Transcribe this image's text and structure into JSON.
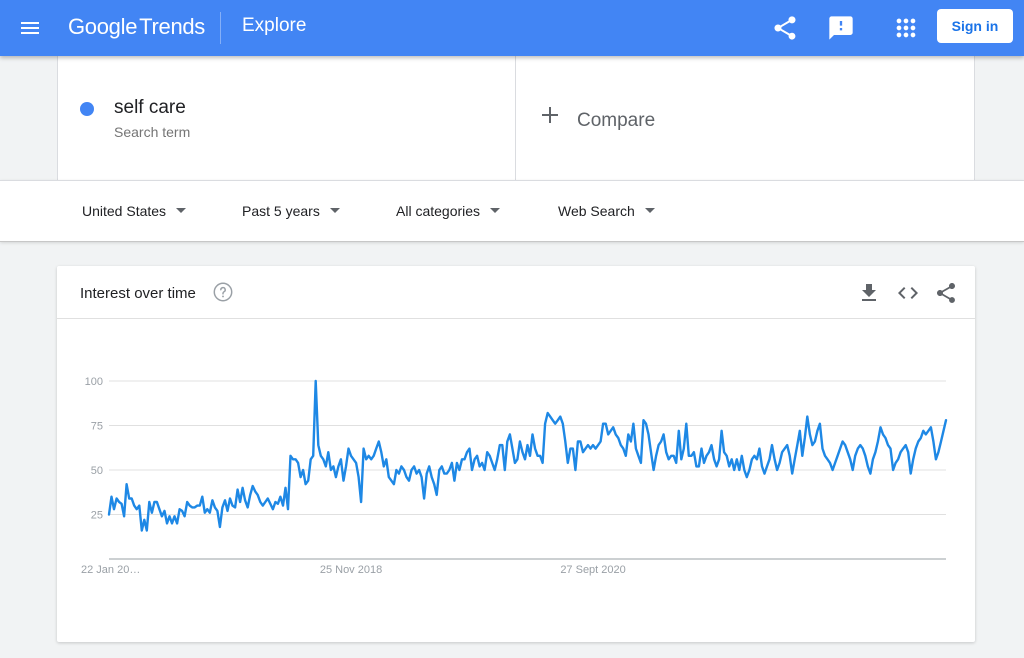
{
  "header": {
    "logo_google": "Google",
    "logo_trends": "Trends",
    "page_title": "Explore",
    "signin_label": "Sign in",
    "icons": [
      "menu-icon",
      "share-icon",
      "feedback-icon",
      "apps-icon"
    ]
  },
  "search": {
    "term": "self care",
    "term_type": "Search term",
    "term_color": "#4285f4",
    "compare_label": "Compare"
  },
  "filters": {
    "region": "United States",
    "time": "Past 5 years",
    "category": "All categories",
    "property": "Web Search"
  },
  "card": {
    "title": "Interest over time",
    "icons": [
      "help-icon",
      "download-icon",
      "embed-icon",
      "share-icon"
    ]
  },
  "colors": {
    "header": "#4285f4",
    "series": "#1e88e5"
  },
  "chart_data": {
    "type": "line",
    "y_ticks": [
      "100",
      "75",
      "50",
      "25"
    ],
    "ylim": [
      0,
      100
    ],
    "x_tick_labels": [
      "22 Jan 20…",
      "25 Nov 2018",
      "27 Sept 2020"
    ],
    "x_tick_weeks": [
      0,
      96,
      192
    ],
    "series": [
      {
        "values": [
          25,
          35,
          28,
          34,
          32,
          31,
          24,
          42,
          34,
          34,
          30,
          28,
          30,
          16,
          22,
          16,
          32,
          26,
          32,
          32,
          28,
          24,
          27,
          20,
          24,
          20,
          24,
          20,
          28,
          27,
          24,
          32,
          30,
          29,
          29,
          30,
          30,
          35,
          26,
          28,
          26,
          33,
          29,
          27,
          18,
          29,
          33,
          27,
          34,
          30,
          29,
          39,
          32,
          40,
          33,
          29,
          36,
          41,
          38,
          36,
          32,
          30,
          32,
          34,
          31,
          28,
          32,
          31,
          35,
          30,
          40,
          28,
          58,
          56,
          56,
          54,
          46,
          50,
          42,
          44,
          56,
          58,
          100,
          64,
          58,
          56,
          52,
          60,
          50,
          52,
          46,
          52,
          56,
          44,
          52,
          62,
          58,
          56,
          54,
          46,
          32,
          62,
          56,
          58,
          56,
          58,
          62,
          66,
          60,
          52,
          56,
          46,
          44,
          42,
          50,
          48,
          52,
          50,
          46,
          44,
          50,
          52,
          48,
          50,
          46,
          34,
          48,
          52,
          46,
          42,
          36,
          50,
          52,
          48,
          48,
          50,
          54,
          44,
          54,
          50,
          56,
          56,
          60,
          62,
          50,
          56,
          58,
          52,
          54,
          50,
          60,
          58,
          54,
          50,
          56,
          64,
          64,
          50,
          66,
          70,
          62,
          54,
          56,
          66,
          60,
          56,
          64,
          58,
          70,
          62,
          58,
          58,
          54,
          76,
          82,
          80,
          78,
          76,
          78,
          80,
          76,
          66,
          54,
          62,
          62,
          50,
          66,
          66,
          60,
          62,
          64,
          62,
          64,
          62,
          64,
          66,
          76,
          76,
          70,
          72,
          74,
          70,
          68,
          64,
          62,
          58,
          70,
          66,
          76,
          62,
          58,
          54,
          78,
          76,
          70,
          60,
          50,
          58,
          64,
          66,
          70,
          60,
          56,
          58,
          58,
          54,
          72,
          56,
          62,
          76,
          58,
          58,
          60,
          52,
          52,
          62,
          54,
          58,
          60,
          64,
          56,
          52,
          56,
          72,
          60,
          58,
          52,
          56,
          50,
          56,
          50,
          58,
          50,
          46,
          50,
          56,
          58,
          56,
          62,
          52,
          48,
          52,
          56,
          64,
          56,
          50,
          54,
          60,
          62,
          64,
          58,
          48,
          56,
          64,
          72,
          58,
          68,
          80,
          70,
          64,
          66,
          72,
          76,
          62,
          58,
          56,
          54,
          50,
          54,
          58,
          62,
          66,
          64,
          60,
          56,
          50,
          58,
          62,
          64,
          62,
          58,
          52,
          48,
          56,
          60,
          66,
          74,
          70,
          68,
          64,
          62,
          50,
          54,
          56,
          60,
          62,
          64,
          60,
          48,
          56,
          62,
          66,
          68,
          72,
          70,
          72,
          74,
          66,
          56,
          60,
          66,
          72,
          78
        ]
      }
    ]
  }
}
